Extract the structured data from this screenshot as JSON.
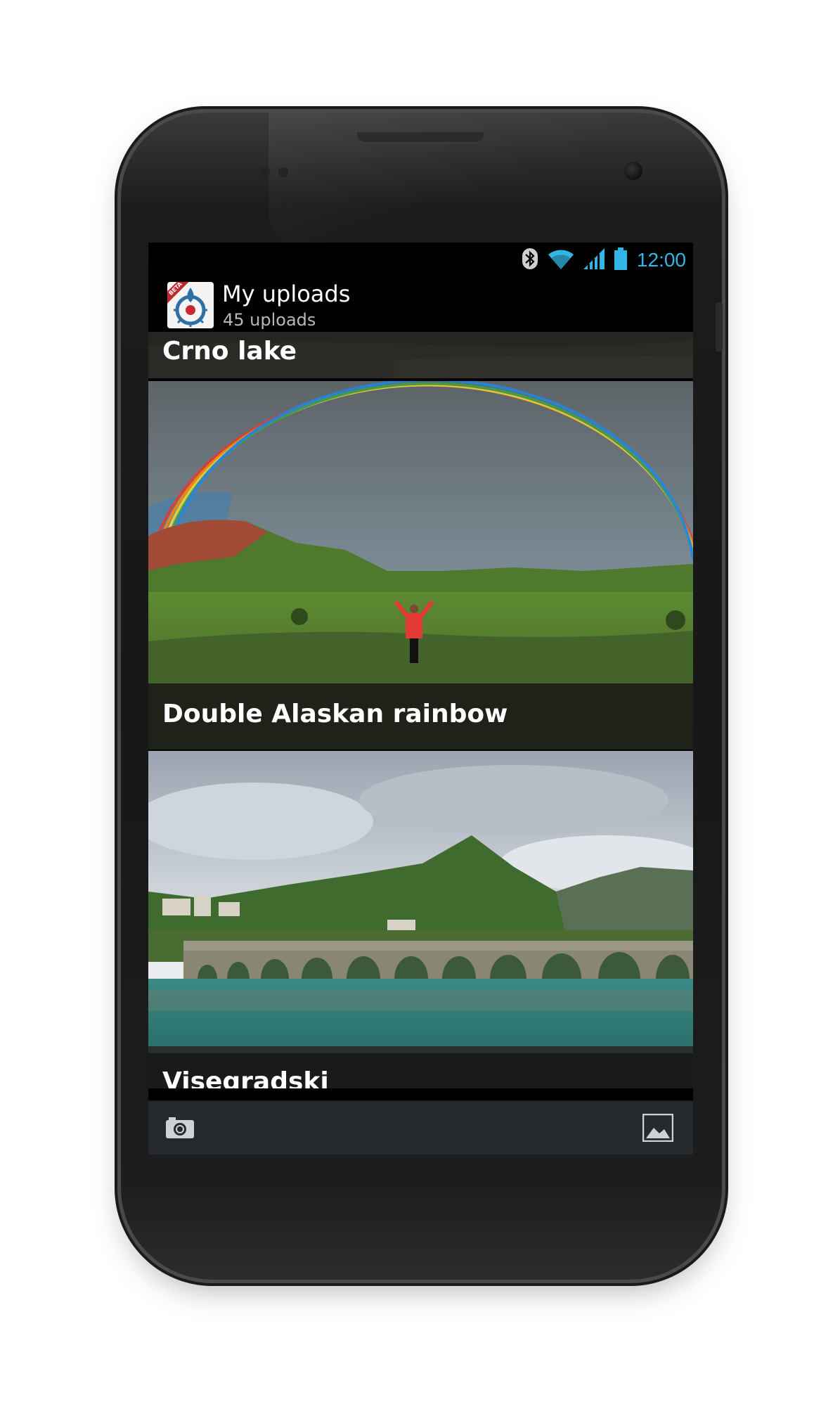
{
  "status_bar": {
    "time": "12:00",
    "icons": [
      "bluetooth-icon",
      "wifi-icon",
      "signal-icon",
      "battery-icon"
    ],
    "accent_color": "#33b5e5"
  },
  "action_bar": {
    "app_icon": "wikimedia-commons-icon",
    "badge": "BETA",
    "title": "My uploads",
    "subtitle": "45 uploads"
  },
  "uploads": [
    {
      "caption": "Crno lake"
    },
    {
      "caption": "Double Alaskan rainbow"
    },
    {
      "caption": "Visegradski"
    }
  ],
  "bottom_bar": {
    "left_icon": "camera-icon",
    "right_icon": "gallery-icon"
  }
}
